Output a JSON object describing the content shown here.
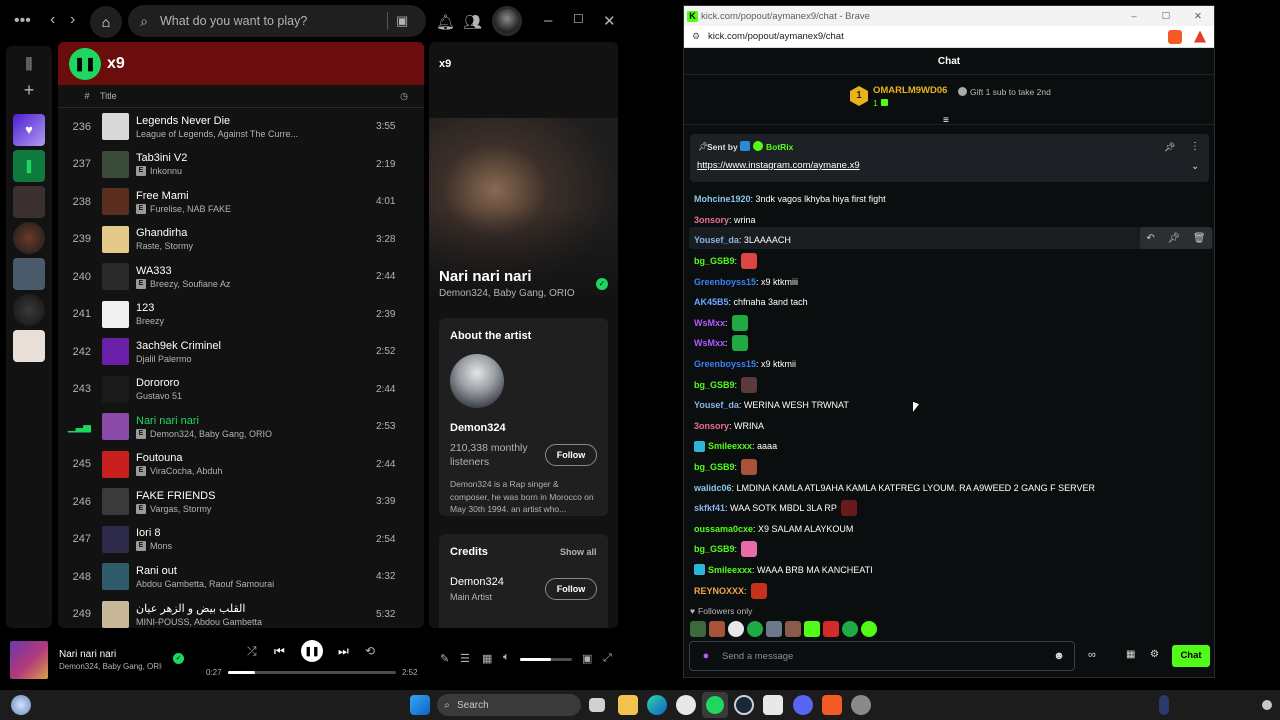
{
  "spotify": {
    "search_placeholder": "What do you want to play?",
    "playlist_title": "x9",
    "col_hash": "#",
    "col_title": "Title",
    "rows": [
      {
        "num": "236",
        "title": "Legends Never Die",
        "artist": "League of Legends, Against The Curre...",
        "explicit": false,
        "dur": "3:55",
        "color": "#d9d9d9"
      },
      {
        "num": "237",
        "title": "Tab3ini V2",
        "artist": "Inkonnu",
        "explicit": true,
        "dur": "2:19",
        "color": "#3b4b3a"
      },
      {
        "num": "238",
        "title": "Free Mami",
        "artist": "Furelise, NAB FAKE",
        "explicit": true,
        "dur": "4:01",
        "color": "#5a2e1f"
      },
      {
        "num": "239",
        "title": "Ghandirha",
        "artist": "Raste, Stormy",
        "explicit": false,
        "dur": "3:28",
        "color": "#e5c98a"
      },
      {
        "num": "240",
        "title": "WA333",
        "artist": "Breezy, Soufiane Az",
        "explicit": true,
        "dur": "2:44",
        "color": "#2a2a2a"
      },
      {
        "num": "241",
        "title": "123",
        "artist": "Breezy",
        "explicit": false,
        "dur": "2:39",
        "color": "#f0f0f0"
      },
      {
        "num": "242",
        "title": "3ach9ek Criminel",
        "artist": "Djalil Palermo",
        "explicit": false,
        "dur": "2:52",
        "color": "#6a1fa8"
      },
      {
        "num": "243",
        "title": "Dorororo",
        "artist": "Gustavo 51",
        "explicit": false,
        "dur": "2:44",
        "color": "#1a1a1a"
      },
      {
        "num": "",
        "title": "Nari nari nari",
        "artist": "Demon324, Baby Gang, ORIO",
        "explicit": true,
        "dur": "2:53",
        "color": "#8a4aa8",
        "active": true
      },
      {
        "num": "245",
        "title": "Foutouna",
        "artist": "ViraCocha, Abduh",
        "explicit": true,
        "dur": "2:44",
        "color": "#c8201e"
      },
      {
        "num": "246",
        "title": "FAKE FRIENDS",
        "artist": "Vargas, Stormy",
        "explicit": true,
        "dur": "3:39",
        "color": "#3a3a3a"
      },
      {
        "num": "247",
        "title": "Iori 8",
        "artist": "Mons",
        "explicit": true,
        "dur": "2:54",
        "color": "#2d2a4a"
      },
      {
        "num": "248",
        "title": "Rani out",
        "artist": "Abdou Gambetta, Raouf Samourai",
        "explicit": false,
        "dur": "4:32",
        "color": "#2f5b6b"
      },
      {
        "num": "249",
        "title": "القلب بيض و الزهر عيان",
        "artist": "MINI-POUSS, Abdou Gambetta",
        "explicit": false,
        "dur": "5:32",
        "color": "#c9b79a"
      }
    ],
    "now_playing": {
      "panel_title": "x9",
      "song": "Nari nari nari",
      "artists": "Demon324, Baby Gang, ORIO",
      "about_label": "About the artist",
      "artist_name": "Demon324",
      "listeners": "210,338 monthly listeners",
      "follow": "Follow",
      "bio": "Demon324 is a Rap singer & composer, he was born in Morocco on May 30th 1994. an artist who...",
      "credits_label": "Credits",
      "show_all": "Show all",
      "credit_name": "Demon324",
      "credit_role": "Main Artist"
    },
    "player": {
      "song": "Nari nari nari",
      "artists": "Demon324, Baby Gang, ORIO",
      "elapsed": "0:27",
      "total": "2:52",
      "progress": 0.16,
      "volume": 0.6
    }
  },
  "browser": {
    "title": "kick.com/popout/aymanex9/chat - Brave",
    "url": "kick.com/popout/aymanex9/chat",
    "chat_header": "Chat",
    "gift": {
      "rank": "1",
      "user": "OMARLM9WD06",
      "count": "1",
      "cta": "Gift 1 sub to take 2nd"
    },
    "pinned": {
      "sent_by": "Sent by",
      "bot": "BotRix",
      "link": "https://www.instagram.com/aymane.x9"
    },
    "messages": [
      {
        "user": "Mohcine1920",
        "color": "#8ac6e8",
        "text": ": 3ndk vagos lkhyba hiya first fight",
        "emotes": []
      },
      {
        "user": "3onsory",
        "color": "#e8718f",
        "text": ": wrina",
        "emotes": []
      },
      {
        "user": "Yousef_da",
        "color": "#8ab4e8",
        "text": ": 3LAAAACH",
        "emotes": []
      },
      {
        "user": "bg_GSB9",
        "color": "#53fc18",
        "text": ":",
        "emotes": [
          "#d44"
        ]
      },
      {
        "user": "Greenboyss15",
        "color": "#3b82f6",
        "text": ": x9 ktkmiii",
        "emotes": []
      },
      {
        "user": "AK45B5",
        "color": "#6aa8ff",
        "text": ": chfnaha 3and tach",
        "emotes": []
      },
      {
        "user": "WsMxx",
        "color": "#b05cff",
        "text": ":",
        "emotes": [
          "#1faa44"
        ]
      },
      {
        "user": "WsMxx",
        "color": "#b05cff",
        "text": ":",
        "emotes": [
          "#1faa44"
        ]
      },
      {
        "user": "Greenboyss15",
        "color": "#3b82f6",
        "text": ": x9 ktkmii",
        "emotes": []
      },
      {
        "user": "bg_GSB9",
        "color": "#53fc18",
        "text": ":",
        "emotes": [
          "#5a3a3a"
        ]
      },
      {
        "user": "Yousef_da",
        "color": "#8ab4e8",
        "text": ": WERINA WESH TRWNAT",
        "emotes": []
      },
      {
        "user": "3onsory",
        "color": "#e8718f",
        "text": ": WRINA",
        "emotes": []
      },
      {
        "user": "Smileexxx",
        "color": "#53fc18",
        "text": ": aaaa",
        "emotes": []
      },
      {
        "user": "bg_GSB9",
        "color": "#53fc18",
        "text": ":",
        "emotes": [
          "#a8523a"
        ]
      },
      {
        "user": "walidc06",
        "color": "#8ac6e8",
        "text": ": LMDINA KAMLA ATL9AHA KAMLA KATFREG LYOUM. RA A9WEED 2 GANG F SERVER",
        "emotes": []
      },
      {
        "user": "skfkf41",
        "color": "#8ab4e8",
        "text": ": WAA SOTK MBDL 3LA RP",
        "emotes": [
          "#6a1a1a"
        ]
      },
      {
        "user": "oussama0cxe",
        "color": "#53fc18",
        "text": ": X9 SALAM ALAYKOUM",
        "emotes": []
      },
      {
        "user": "bg_GSB9",
        "color": "#53fc18",
        "text": ":",
        "emotes": [
          "#e86aa8"
        ]
      },
      {
        "user": "Smileexxx",
        "color": "#53fc18",
        "text": ": WAAA BRB MA KANCHEATI",
        "emotes": []
      },
      {
        "user": "REYNOXXX",
        "color": "#f0a64a",
        "text": ":",
        "emotes": [
          "#c8301e"
        ]
      }
    ],
    "followers_only": "Followers only",
    "input_placeholder": "Send a message",
    "chat_button": "Chat"
  },
  "taskbar": {
    "search": "Search"
  }
}
